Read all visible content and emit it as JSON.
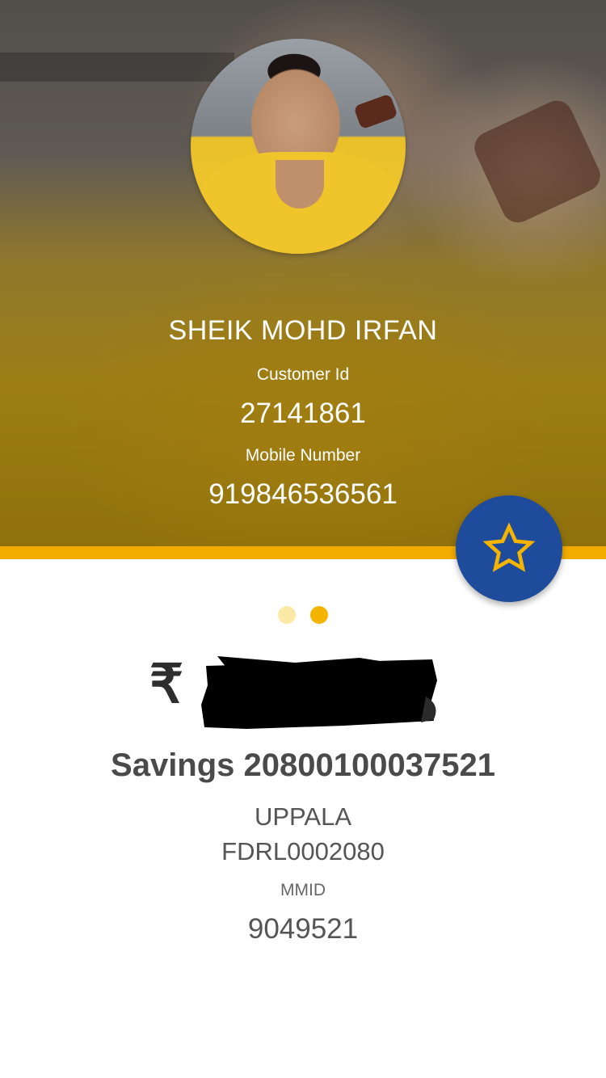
{
  "profile": {
    "name": "SHEIK MOHD IRFAN",
    "customer_id_label": "Customer Id",
    "customer_id": "27141861",
    "mobile_label": "Mobile Number",
    "mobile": "919846536561"
  },
  "favorite_button": {
    "icon": "star-icon"
  },
  "pager": {
    "count": 2,
    "active_index": 1
  },
  "account": {
    "currency_symbol": "₹",
    "title": "Savings 20800100037521",
    "branch": "UPPALA",
    "ifsc": "FDRL0002080",
    "mmid_label": "MMID",
    "mmid": "9049521"
  },
  "colors": {
    "accent": "#f2ac00",
    "fab": "#1f4b9c",
    "star": "#f4b400",
    "dot_active": "#f4b400",
    "dot_inactive": "#fbeaa5"
  }
}
